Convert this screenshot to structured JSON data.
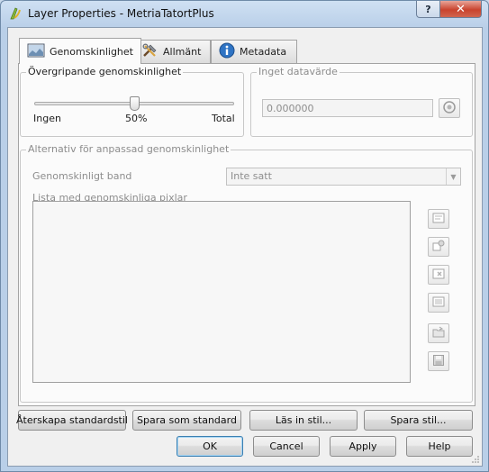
{
  "window": {
    "title": "Layer Properties - MetriaTatortPlus",
    "help_label": "?",
    "close_label": "✕"
  },
  "tabs": [
    {
      "label": "Genomskinlighet",
      "icon": "transparency-icon",
      "active": true
    },
    {
      "label": "Allmänt",
      "icon": "tools-icon",
      "active": false
    },
    {
      "label": "Metadata",
      "icon": "info-icon",
      "active": false
    }
  ],
  "transparency": {
    "group_title": "Övergripande genomskinlighet",
    "min_label": "Ingen",
    "value_label": "50%",
    "max_label": "Total",
    "slider_value": 0.5
  },
  "nodata": {
    "group_title": "Inget datavärde",
    "value": "0.000000"
  },
  "custom": {
    "group_title": "Alternativ för anpassad genomskinlighet",
    "band_label": "Genomskinligt band",
    "band_value": "Inte satt",
    "list_label": "Lista med genomskinliga pixlar"
  },
  "style_buttons": {
    "restore": "Återskapa standardstil",
    "save_default": "Spara som standard",
    "load": "Läs in stil...",
    "save": "Spara stil..."
  },
  "dialog_buttons": {
    "ok": "OK",
    "cancel": "Cancel",
    "apply": "Apply",
    "help": "Help"
  }
}
